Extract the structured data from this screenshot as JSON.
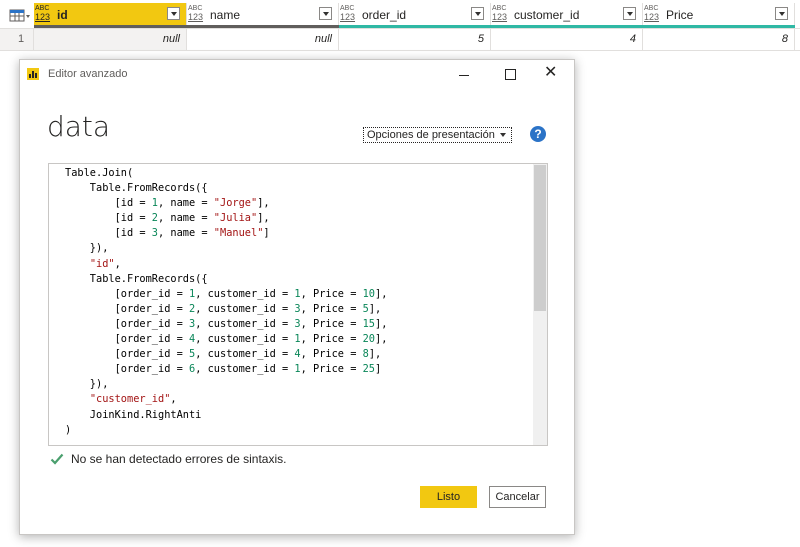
{
  "grid": {
    "columns": [
      {
        "type_top": "ABC",
        "type_bottom": "123",
        "name": "id"
      },
      {
        "type_top": "ABC",
        "type_bottom": "123",
        "name": "name"
      },
      {
        "type_top": "ABC",
        "type_bottom": "123",
        "name": "order_id"
      },
      {
        "type_top": "ABC",
        "type_bottom": "123",
        "name": "customer_id"
      },
      {
        "type_top": "ABC",
        "type_bottom": "123",
        "name": "Price"
      }
    ],
    "row_number": "1",
    "row": [
      "null",
      "null",
      "5",
      "4",
      "8"
    ]
  },
  "dialog": {
    "title": "Editor avanzado",
    "query_name": "data",
    "display_options": "Opciones de presentación",
    "help": "?",
    "status": "No se han detectado errores de sintaxis.",
    "ok_label": "Listo",
    "cancel_label": "Cancelar"
  },
  "code_lines": [
    "Table.Join(",
    "    Table.FromRecords({",
    "        [id = 1, name = \"Jorge\"],",
    "        [id = 2, name = \"Julia\"],",
    "        [id = 3, name = \"Manuel\"]",
    "    }),",
    "    \"id\",",
    "    Table.FromRecords({",
    "        [order_id = 1, customer_id = 1, Price = 10],",
    "        [order_id = 2, customer_id = 3, Price = 5],",
    "        [order_id = 3, customer_id = 3, Price = 15],",
    "        [order_id = 4, customer_id = 1, Price = 20],",
    "        [order_id = 5, customer_id = 4, Price = 8],",
    "        [order_id = 6, customer_id = 1, Price = 25]",
    "    }),",
    "    \"customer_id\",",
    "    JoinKind.RightAnti",
    ")"
  ],
  "colors": {
    "accent": "#f2c811",
    "quality_bar": "#2fb8a4",
    "help": "#2b73c7",
    "check": "#4a9f6e",
    "string": "#a31515",
    "number": "#098658"
  }
}
